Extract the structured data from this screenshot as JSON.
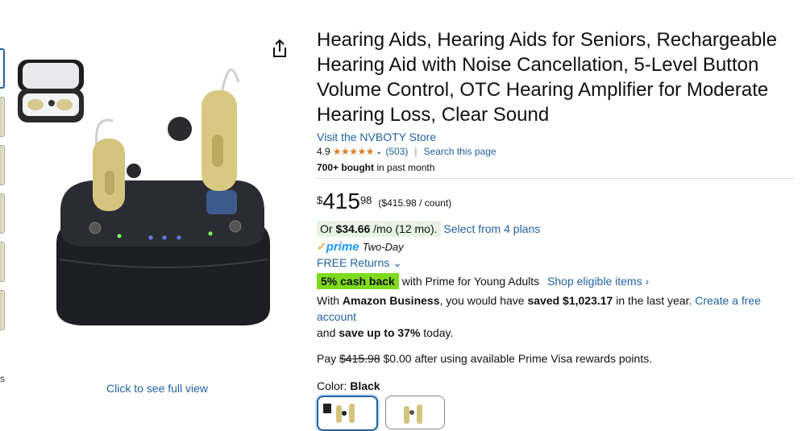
{
  "product": {
    "title": "Hearing Aids, Hearing Aids for Seniors, Rechargeable Hearing Aid with Noise Cancellation, 5-Level Button Volume Control, OTC Hearing Amplifier for Moderate Hearing Loss, Clear Sound",
    "store_link": "Visit the NVBOTY Store",
    "rating": "4.9",
    "stars": "★★★★★",
    "review_count": "(503)",
    "separator": "|",
    "search_page": "Search this page",
    "bought_bold": "700+ bought",
    "bought_rest": " in past month"
  },
  "price": {
    "currency": "$",
    "whole": "415",
    "fraction": "98",
    "unit_price": "($415.98 / count)"
  },
  "monthly": {
    "or_text": "Or ",
    "amount": "$34.66",
    "suffix": " /mo (12 mo).",
    "plans_link": "Select from 4 plans"
  },
  "shipping": {
    "check": "✓",
    "prime": "prime",
    "two_day": "Two-Day",
    "returns": "FREE Returns"
  },
  "cashback": {
    "badge": "5% cash back",
    "text": " with Prime for Young Adults",
    "eligible": "Shop eligible items ›"
  },
  "business": {
    "p1": "With ",
    "amazon_business": "Amazon Business",
    "p2": ", you would have ",
    "saved": "saved $1,023.17",
    "p3": " in the last year. ",
    "create_link": "Create a free account",
    "p4": "and ",
    "save_up": "save up to 37%",
    "p5": " today."
  },
  "visa": {
    "pay": "Pay ",
    "old": "$415.98",
    "rest": " $0.00 after using available Prime Visa rewards points."
  },
  "color": {
    "label": "Color: ",
    "value": "Black"
  },
  "gallery": {
    "full_view": "Click to see full view",
    "stray": "s"
  },
  "colors": {
    "link": "#2162a1",
    "star": "#de7921",
    "cashback": "#7fda1e",
    "prime": "#1a98ff"
  }
}
